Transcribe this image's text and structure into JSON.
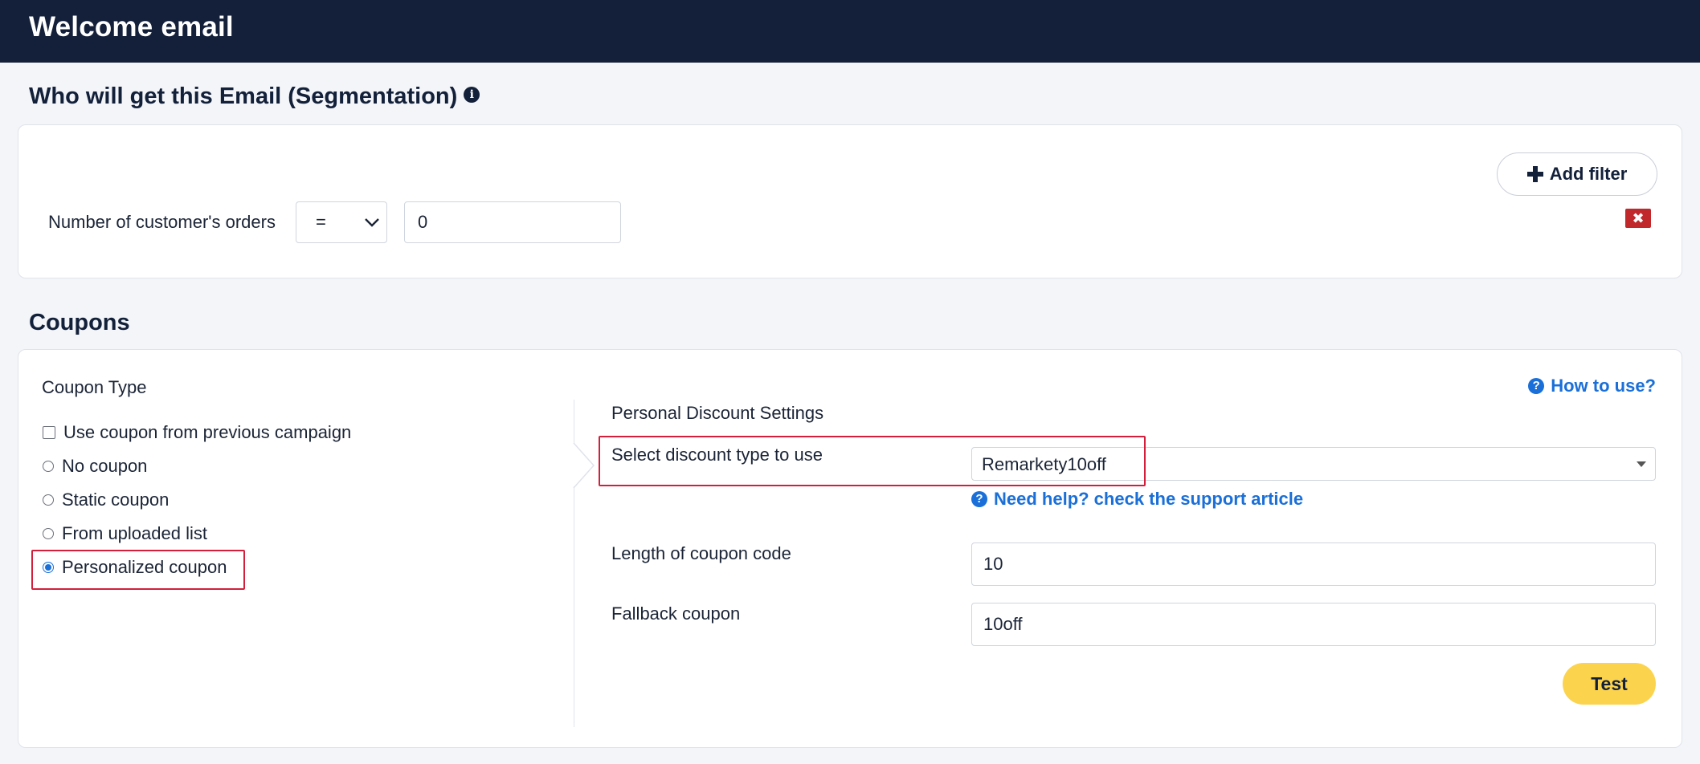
{
  "header": {
    "title": "Welcome email"
  },
  "segmentation": {
    "title": "Who will get this Email (Segmentation)",
    "add_filter_label": "Add filter",
    "filter": {
      "label": "Number of customer's orders",
      "operator": "=",
      "value": "0"
    },
    "delete_symbol": "✖"
  },
  "coupons": {
    "title": "Coupons",
    "coupon_type_label": "Coupon Type",
    "how_to_use": "How to use?",
    "options": [
      {
        "label": "Use coupon from previous campaign",
        "kind": "checkbox",
        "checked": false
      },
      {
        "label": "No coupon",
        "kind": "radio",
        "checked": false
      },
      {
        "label": "Static coupon",
        "kind": "radio",
        "checked": false
      },
      {
        "label": "From uploaded list",
        "kind": "radio",
        "checked": false
      },
      {
        "label": "Personalized coupon",
        "kind": "radio",
        "checked": true
      }
    ],
    "personal": {
      "heading": "Personal Discount Settings",
      "discount_type_label": "Select discount type to use",
      "discount_type_value": "Remarkety10off",
      "help_link": "Need help? check the support article",
      "length_label": "Length of coupon code",
      "length_value": "10",
      "fallback_label": "Fallback coupon",
      "fallback_value": "10off",
      "test_label": "Test"
    }
  },
  "colors": {
    "header_bg": "#14203a",
    "accent": "#1a6fd8",
    "highlight": "#d31f3c",
    "test_button": "#fcd34d",
    "delete": "#c0282c"
  }
}
